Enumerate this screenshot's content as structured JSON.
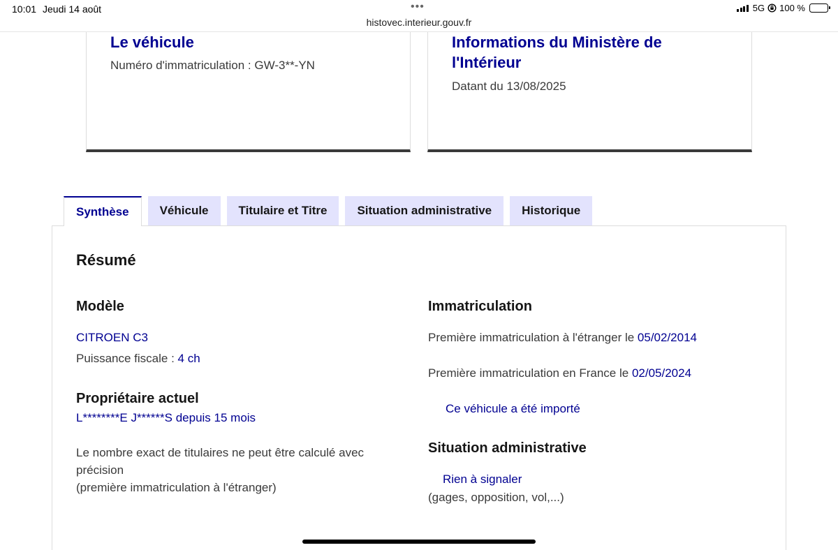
{
  "status_bar": {
    "time": "10:01",
    "date": "Jeudi 14 août",
    "more": "•••",
    "url": "histovec.interieur.gouv.fr",
    "network": "5G",
    "battery": "100 %"
  },
  "cards": {
    "vehicle": {
      "title": "Le véhicule",
      "plate_label": "Numéro d'immatriculation : ",
      "plate_value": "GW-3**-YN"
    },
    "ministry": {
      "title_line1": "Informations du Ministère de",
      "title_line2": "l'Intérieur",
      "date_text": "Datant du 13/08/2025"
    }
  },
  "tabs": [
    {
      "label": "Synthèse",
      "active": true
    },
    {
      "label": "Véhicule",
      "active": false
    },
    {
      "label": "Titulaire et Titre",
      "active": false
    },
    {
      "label": "Situation administrative",
      "active": false
    },
    {
      "label": "Historique",
      "active": false
    }
  ],
  "summary": {
    "title": "Résumé",
    "model": {
      "heading": "Modèle",
      "name": "CITROEN C3",
      "power_label": "Puissance fiscale : ",
      "power_value": "4 ch"
    },
    "owner": {
      "heading": "Propriétaire actuel",
      "name": "L********E J******S",
      "since_label": " depuis ",
      "since_value": "15 mois",
      "note_line1": "Le nombre exact de titulaires ne peut être calculé avec",
      "note_line2": "précision",
      "note_line3": "(première immatriculation à l'étranger)"
    },
    "registration": {
      "heading": "Immatriculation",
      "foreign_label": "Première immatriculation à l'étranger le ",
      "foreign_date": "05/02/2014",
      "france_label": "Première immatriculation en France le ",
      "france_date": "02/05/2024",
      "imported": "Ce véhicule a été importé"
    },
    "admin": {
      "heading": "Situation administrative",
      "status": "Rien à signaler",
      "details": "(gages, opposition, vol,...)"
    }
  }
}
